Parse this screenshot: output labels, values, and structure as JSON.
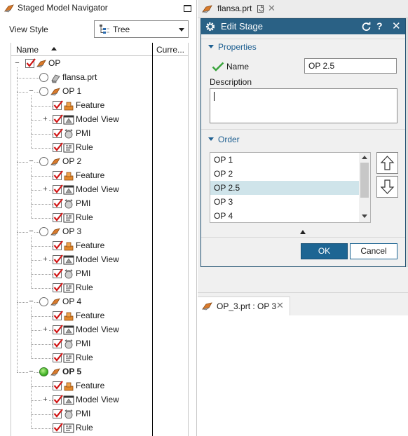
{
  "navigator": {
    "title": "Staged Model Navigator",
    "view_style_label": "View Style",
    "view_style_value": "Tree",
    "columns": {
      "name": "Name",
      "current": "Curre..."
    },
    "tree": [
      {
        "label": "OP",
        "level": 0,
        "marker": "checkbox",
        "icon": "op-stage-icon",
        "expander": "minus",
        "bold": false
      },
      {
        "label": "flansa.prt",
        "level": 1,
        "marker": "radio",
        "icon": "part-icon",
        "expander": "none",
        "bold": false
      },
      {
        "label": "OP 1",
        "level": 1,
        "marker": "radio",
        "icon": "op-stage-icon",
        "expander": "minus",
        "bold": false
      },
      {
        "label": "Feature",
        "level": 2,
        "marker": "checkbox",
        "icon": "feature-icon",
        "expander": "none",
        "bold": false
      },
      {
        "label": "Model View",
        "level": 2,
        "marker": "checkbox",
        "icon": "model-view-icon",
        "expander": "plus",
        "bold": false
      },
      {
        "label": "PMI",
        "level": 2,
        "marker": "checkbox",
        "icon": "pmi-icon",
        "expander": "none",
        "bold": false
      },
      {
        "label": "Rule",
        "level": 2,
        "marker": "checkbox",
        "icon": "rule-icon",
        "expander": "none",
        "bold": false
      },
      {
        "label": "OP 2",
        "level": 1,
        "marker": "radio",
        "icon": "op-stage-icon",
        "expander": "minus",
        "bold": false
      },
      {
        "label": "Feature",
        "level": 2,
        "marker": "checkbox",
        "icon": "feature-icon",
        "expander": "none",
        "bold": false
      },
      {
        "label": "Model View",
        "level": 2,
        "marker": "checkbox",
        "icon": "model-view-icon",
        "expander": "plus",
        "bold": false
      },
      {
        "label": "PMI",
        "level": 2,
        "marker": "checkbox",
        "icon": "pmi-icon",
        "expander": "none",
        "bold": false
      },
      {
        "label": "Rule",
        "level": 2,
        "marker": "checkbox",
        "icon": "rule-icon",
        "expander": "none",
        "bold": false
      },
      {
        "label": "OP 3",
        "level": 1,
        "marker": "radio",
        "icon": "op-stage-icon",
        "expander": "minus",
        "bold": false
      },
      {
        "label": "Feature",
        "level": 2,
        "marker": "checkbox",
        "icon": "feature-icon",
        "expander": "none",
        "bold": false
      },
      {
        "label": "Model View",
        "level": 2,
        "marker": "checkbox",
        "icon": "model-view-icon",
        "expander": "plus",
        "bold": false
      },
      {
        "label": "PMI",
        "level": 2,
        "marker": "checkbox",
        "icon": "pmi-icon",
        "expander": "none",
        "bold": false
      },
      {
        "label": "Rule",
        "level": 2,
        "marker": "checkbox",
        "icon": "rule-icon",
        "expander": "none",
        "bold": false
      },
      {
        "label": "OP 4",
        "level": 1,
        "marker": "radio",
        "icon": "op-stage-icon",
        "expander": "minus",
        "bold": false
      },
      {
        "label": "Feature",
        "level": 2,
        "marker": "checkbox",
        "icon": "feature-icon",
        "expander": "none",
        "bold": false
      },
      {
        "label": "Model View",
        "level": 2,
        "marker": "checkbox",
        "icon": "model-view-icon",
        "expander": "plus",
        "bold": false
      },
      {
        "label": "PMI",
        "level": 2,
        "marker": "checkbox",
        "icon": "pmi-icon",
        "expander": "none",
        "bold": false
      },
      {
        "label": "Rule",
        "level": 2,
        "marker": "checkbox",
        "icon": "rule-icon",
        "expander": "none",
        "bold": false
      },
      {
        "label": "OP 5",
        "level": 1,
        "marker": "radio-active",
        "icon": "op-stage-icon",
        "expander": "minus",
        "bold": true
      },
      {
        "label": "Feature",
        "level": 2,
        "marker": "checkbox",
        "icon": "feature-icon",
        "expander": "none",
        "bold": false
      },
      {
        "label": "Model View",
        "level": 2,
        "marker": "checkbox",
        "icon": "model-view-icon",
        "expander": "plus",
        "bold": false
      },
      {
        "label": "PMI",
        "level": 2,
        "marker": "checkbox",
        "icon": "pmi-icon",
        "expander": "none",
        "bold": false
      },
      {
        "label": "Rule",
        "level": 2,
        "marker": "checkbox",
        "icon": "rule-icon",
        "expander": "none",
        "bold": false
      }
    ]
  },
  "doc_tab": {
    "label": "flansa.prt"
  },
  "edit_stage": {
    "title": "Edit Stage",
    "properties_label": "Properties",
    "name_label": "Name",
    "name_value": "OP 2.5",
    "description_label": "Description",
    "description_value": "",
    "order_label": "Order",
    "order_items": [
      "OP 1",
      "OP 2",
      "OP 2.5",
      "OP 3",
      "OP 4"
    ],
    "order_selected": "OP 2.5",
    "ok_label": "OK",
    "cancel_label": "Cancel"
  },
  "viewport_tab": {
    "label": "OP_3.prt : OP 3"
  },
  "colors": {
    "accent": "#2a6185",
    "section_header": "#1e5f91",
    "check_red": "#d01414",
    "selection": "#cfe4ea",
    "active_stage_green": "#45b52a"
  }
}
